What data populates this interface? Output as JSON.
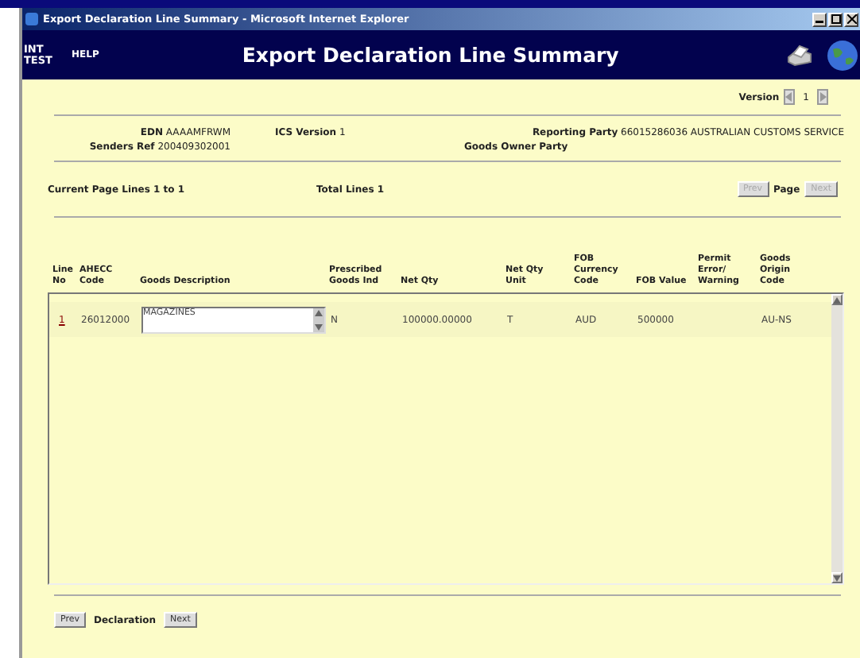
{
  "window": {
    "title": "Export Declaration Line Summary - Microsoft Internet Explorer"
  },
  "header": {
    "env": "INT TEST",
    "help": "HELP",
    "title": "Export Declaration Line Summary"
  },
  "version": {
    "label": "Version",
    "value": "1"
  },
  "info": [
    {
      "label": "EDN",
      "value": "AAAAMFRWM"
    },
    {
      "label": "ICS Version",
      "value": "1"
    },
    {
      "label": "Reporting Party",
      "value": "66015286036  AUSTRALIAN CUSTOMS SERVICE"
    },
    {
      "label": "Senders Ref",
      "value": "200409302001"
    },
    {
      "label": "Goods Owner Party"
    }
  ],
  "paging": {
    "current": "Current Page Lines 1 to 1",
    "total": "Total Lines 1",
    "prev": {
      "label": "Prev",
      "disabled": true
    },
    "page": "Page",
    "next": {
      "label": "Next",
      "disabled": true
    }
  },
  "table": {
    "columns": [
      "Line No",
      "AHECC Code",
      "Goods Description",
      "Prescribed Goods Ind",
      "Net Qty",
      "Net Qty Unit",
      "FOB Currency Code",
      "FOB Value",
      "Permit Error/ Warning",
      "Goods Origin Code"
    ],
    "rows": [
      {
        "line": "1",
        "ahecc": "26012000",
        "description": "MAGAZINES",
        "prescribed": "N",
        "net_qty": "100000.00000",
        "unit": "T",
        "currency": "AUD",
        "fob_value": "500000",
        "origin": "AU-NS"
      }
    ]
  },
  "footer": {
    "prev": {
      "label": "Prev",
      "disabled": false
    },
    "label": "Declaration",
    "next": {
      "label": "Next",
      "disabled": false
    }
  }
}
